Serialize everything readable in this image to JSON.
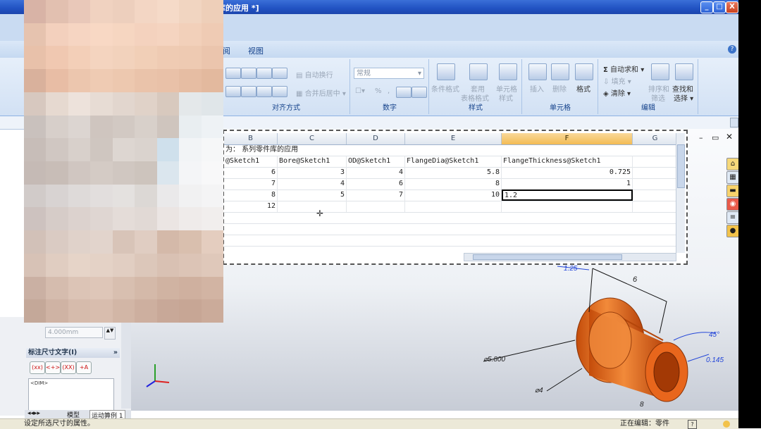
{
  "window": {
    "title": "[系列零件库的应用 *]",
    "controls": [
      "_",
      "□",
      "X"
    ]
  },
  "ribbon": {
    "tabs": [
      "阅",
      "视图"
    ],
    "groups": {
      "alignment": {
        "label": "对齐方式",
        "wrap_text": "自动换行",
        "merge_center": "合并后居中"
      },
      "number": {
        "label": "数字",
        "format_value": "常规",
        "percent": "%"
      },
      "styles": {
        "label": "样式",
        "conditional": "条件格式",
        "table_line1": "套用",
        "table_line2": "表格格式",
        "cell_line1": "单元格",
        "cell_line2": "样式"
      },
      "cells": {
        "label": "单元格",
        "insert": "插入",
        "delete": "删除",
        "format": "格式"
      },
      "editing": {
        "label": "编辑",
        "autosum": "自动求和",
        "fill": "填充",
        "clear": "清除",
        "sort_line1": "排序和",
        "sort_line2": "筛选",
        "find_line1": "查找和",
        "find_line2": "选择"
      }
    }
  },
  "spreadsheet": {
    "columns": [
      "B",
      "C",
      "D",
      "E",
      "F",
      "G"
    ],
    "selected_column": "F",
    "title_row": {
      "prefix": "为：",
      "text": "系列零件库的应用"
    },
    "header_row": [
      "@Sketch1",
      "Bore@Sketch1",
      "OD@Sketch1",
      "FlangeDia@Sketch1",
      "FlangeThickness@Sketch1",
      ""
    ],
    "rows": [
      [
        "6",
        "3",
        "4",
        "5.8",
        "0.725"
      ],
      [
        "7",
        "4",
        "6",
        "8",
        "1"
      ],
      [
        "8",
        "5",
        "7",
        "10",
        "1.2"
      ],
      [
        "12",
        "",
        "",
        "",
        ""
      ]
    ],
    "active_cell_value": "1.2"
  },
  "feature_manager": {
    "spinner_value": "4.000mm",
    "dim_text_title": "标注尺寸文字(I)",
    "dim_buttons": [
      "(xx)",
      "<+>",
      "(XX)",
      "+A"
    ],
    "dim_text_value": "<DIM>",
    "tabs": [
      "模型",
      "运动算例 1"
    ]
  },
  "model_dims": {
    "d1": "1.25",
    "d2": "6",
    "d3": "⌀5.800",
    "d4": "⌀4",
    "d5": "45°",
    "d6": "0.145",
    "d7": "8"
  },
  "statusbar": {
    "left": "设定所选尺寸的属性。",
    "mode": "正在编辑：零件"
  },
  "colors": {
    "part_orange": "#e8661c",
    "selected_col": "#f3bb54",
    "title_blue": "#2152c2"
  }
}
